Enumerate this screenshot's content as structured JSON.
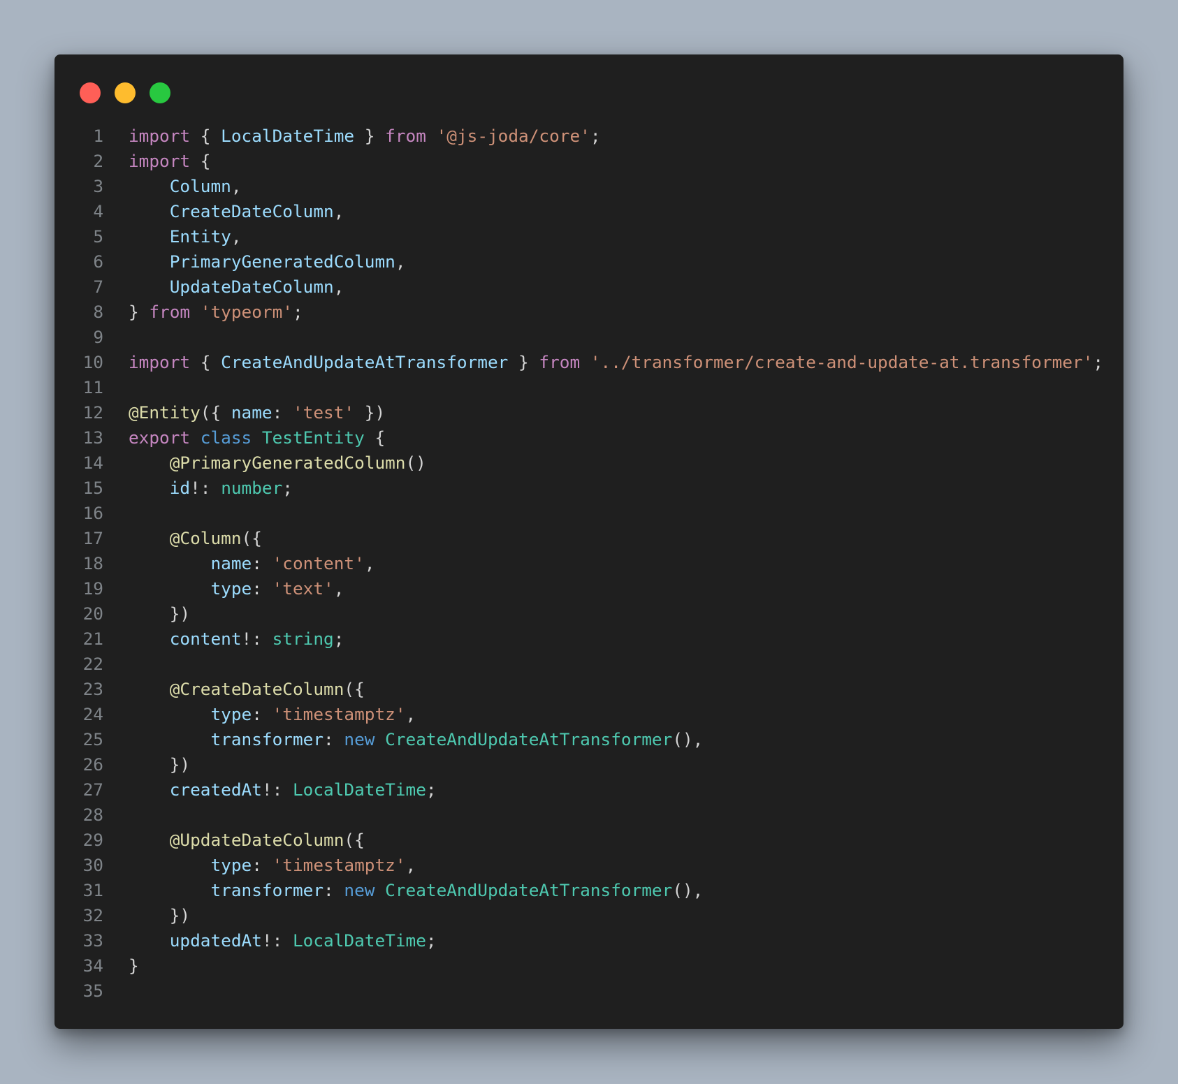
{
  "window": {
    "controls": {
      "close": "#ff5f57",
      "minimize": "#febc2e",
      "maximize": "#28c840"
    }
  },
  "theme": {
    "background": "#1f1f1f",
    "keyword": "#c586c0",
    "keyword_blue": "#569cd6",
    "string": "#ce9178",
    "identifier": "#9cdcfe",
    "type": "#4ec9b0",
    "decorator": "#dcdcaa",
    "punctuation": "#d4d4d4",
    "line_number": "#7f8489"
  },
  "code": {
    "lines": [
      {
        "n": "1",
        "tokens": [
          [
            "kw",
            "import"
          ],
          [
            "pun",
            " { "
          ],
          [
            "id",
            "LocalDateTime"
          ],
          [
            "pun",
            " } "
          ],
          [
            "kw",
            "from"
          ],
          [
            "pun",
            " "
          ],
          [
            "str",
            "'@js-joda/core'"
          ],
          [
            "pun",
            ";"
          ]
        ]
      },
      {
        "n": "2",
        "tokens": [
          [
            "kw",
            "import"
          ],
          [
            "pun",
            " {"
          ]
        ]
      },
      {
        "n": "3",
        "tokens": [
          [
            "pun",
            "    "
          ],
          [
            "id",
            "Column"
          ],
          [
            "pun",
            ","
          ]
        ]
      },
      {
        "n": "4",
        "tokens": [
          [
            "pun",
            "    "
          ],
          [
            "id",
            "CreateDateColumn"
          ],
          [
            "pun",
            ","
          ]
        ]
      },
      {
        "n": "5",
        "tokens": [
          [
            "pun",
            "    "
          ],
          [
            "id",
            "Entity"
          ],
          [
            "pun",
            ","
          ]
        ]
      },
      {
        "n": "6",
        "tokens": [
          [
            "pun",
            "    "
          ],
          [
            "id",
            "PrimaryGeneratedColumn"
          ],
          [
            "pun",
            ","
          ]
        ]
      },
      {
        "n": "7",
        "tokens": [
          [
            "pun",
            "    "
          ],
          [
            "id",
            "UpdateDateColumn"
          ],
          [
            "pun",
            ","
          ]
        ]
      },
      {
        "n": "8",
        "tokens": [
          [
            "pun",
            "} "
          ],
          [
            "kw",
            "from"
          ],
          [
            "pun",
            " "
          ],
          [
            "str",
            "'typeorm'"
          ],
          [
            "pun",
            ";"
          ]
        ]
      },
      {
        "n": "9",
        "tokens": []
      },
      {
        "n": "10",
        "tokens": [
          [
            "kw",
            "import"
          ],
          [
            "pun",
            " { "
          ],
          [
            "id",
            "CreateAndUpdateAtTransformer"
          ],
          [
            "pun",
            " } "
          ],
          [
            "kw",
            "from"
          ],
          [
            "pun",
            " "
          ],
          [
            "str",
            "'../transformer/create-and-update-at.transformer'"
          ],
          [
            "pun",
            ";"
          ]
        ]
      },
      {
        "n": "11",
        "tokens": []
      },
      {
        "n": "12",
        "tokens": [
          [
            "dec",
            "@Entity"
          ],
          [
            "pun",
            "({ "
          ],
          [
            "id",
            "name"
          ],
          [
            "pun",
            ": "
          ],
          [
            "str",
            "'test'"
          ],
          [
            "pun",
            " })"
          ]
        ]
      },
      {
        "n": "13",
        "tokens": [
          [
            "kw",
            "export"
          ],
          [
            "pun",
            " "
          ],
          [
            "kb",
            "class"
          ],
          [
            "pun",
            " "
          ],
          [
            "ty",
            "TestEntity"
          ],
          [
            "pun",
            " {"
          ]
        ]
      },
      {
        "n": "14",
        "tokens": [
          [
            "pun",
            "    "
          ],
          [
            "dec",
            "@PrimaryGeneratedColumn"
          ],
          [
            "pun",
            "()"
          ]
        ]
      },
      {
        "n": "15",
        "tokens": [
          [
            "pun",
            "    "
          ],
          [
            "id",
            "id"
          ],
          [
            "pun",
            "!: "
          ],
          [
            "ty",
            "number"
          ],
          [
            "pun",
            ";"
          ]
        ]
      },
      {
        "n": "16",
        "tokens": []
      },
      {
        "n": "17",
        "tokens": [
          [
            "pun",
            "    "
          ],
          [
            "dec",
            "@Column"
          ],
          [
            "pun",
            "({"
          ]
        ]
      },
      {
        "n": "18",
        "tokens": [
          [
            "pun",
            "        "
          ],
          [
            "id",
            "name"
          ],
          [
            "pun",
            ": "
          ],
          [
            "str",
            "'content'"
          ],
          [
            "pun",
            ","
          ]
        ]
      },
      {
        "n": "19",
        "tokens": [
          [
            "pun",
            "        "
          ],
          [
            "id",
            "type"
          ],
          [
            "pun",
            ": "
          ],
          [
            "str",
            "'text'"
          ],
          [
            "pun",
            ","
          ]
        ]
      },
      {
        "n": "20",
        "tokens": [
          [
            "pun",
            "    })"
          ]
        ]
      },
      {
        "n": "21",
        "tokens": [
          [
            "pun",
            "    "
          ],
          [
            "id",
            "content"
          ],
          [
            "pun",
            "!: "
          ],
          [
            "ty",
            "string"
          ],
          [
            "pun",
            ";"
          ]
        ]
      },
      {
        "n": "22",
        "tokens": []
      },
      {
        "n": "23",
        "tokens": [
          [
            "pun",
            "    "
          ],
          [
            "dec",
            "@CreateDateColumn"
          ],
          [
            "pun",
            "({"
          ]
        ]
      },
      {
        "n": "24",
        "tokens": [
          [
            "pun",
            "        "
          ],
          [
            "id",
            "type"
          ],
          [
            "pun",
            ": "
          ],
          [
            "str",
            "'timestamptz'"
          ],
          [
            "pun",
            ","
          ]
        ]
      },
      {
        "n": "25",
        "tokens": [
          [
            "pun",
            "        "
          ],
          [
            "id",
            "transformer"
          ],
          [
            "pun",
            ": "
          ],
          [
            "kb",
            "new"
          ],
          [
            "pun",
            " "
          ],
          [
            "ty",
            "CreateAndUpdateAtTransformer"
          ],
          [
            "pun",
            "(),"
          ]
        ]
      },
      {
        "n": "26",
        "tokens": [
          [
            "pun",
            "    })"
          ]
        ]
      },
      {
        "n": "27",
        "tokens": [
          [
            "pun",
            "    "
          ],
          [
            "id",
            "createdAt"
          ],
          [
            "pun",
            "!: "
          ],
          [
            "ty",
            "LocalDateTime"
          ],
          [
            "pun",
            ";"
          ]
        ]
      },
      {
        "n": "28",
        "tokens": []
      },
      {
        "n": "29",
        "tokens": [
          [
            "pun",
            "    "
          ],
          [
            "dec",
            "@UpdateDateColumn"
          ],
          [
            "pun",
            "({"
          ]
        ]
      },
      {
        "n": "30",
        "tokens": [
          [
            "pun",
            "        "
          ],
          [
            "id",
            "type"
          ],
          [
            "pun",
            ": "
          ],
          [
            "str",
            "'timestamptz'"
          ],
          [
            "pun",
            ","
          ]
        ]
      },
      {
        "n": "31",
        "tokens": [
          [
            "pun",
            "        "
          ],
          [
            "id",
            "transformer"
          ],
          [
            "pun",
            ": "
          ],
          [
            "kb",
            "new"
          ],
          [
            "pun",
            " "
          ],
          [
            "ty",
            "CreateAndUpdateAtTransformer"
          ],
          [
            "pun",
            "(),"
          ]
        ]
      },
      {
        "n": "32",
        "tokens": [
          [
            "pun",
            "    })"
          ]
        ]
      },
      {
        "n": "33",
        "tokens": [
          [
            "pun",
            "    "
          ],
          [
            "id",
            "updatedAt"
          ],
          [
            "pun",
            "!: "
          ],
          [
            "ty",
            "LocalDateTime"
          ],
          [
            "pun",
            ";"
          ]
        ]
      },
      {
        "n": "34",
        "tokens": [
          [
            "pun",
            "}"
          ]
        ]
      },
      {
        "n": "35",
        "tokens": []
      }
    ]
  }
}
